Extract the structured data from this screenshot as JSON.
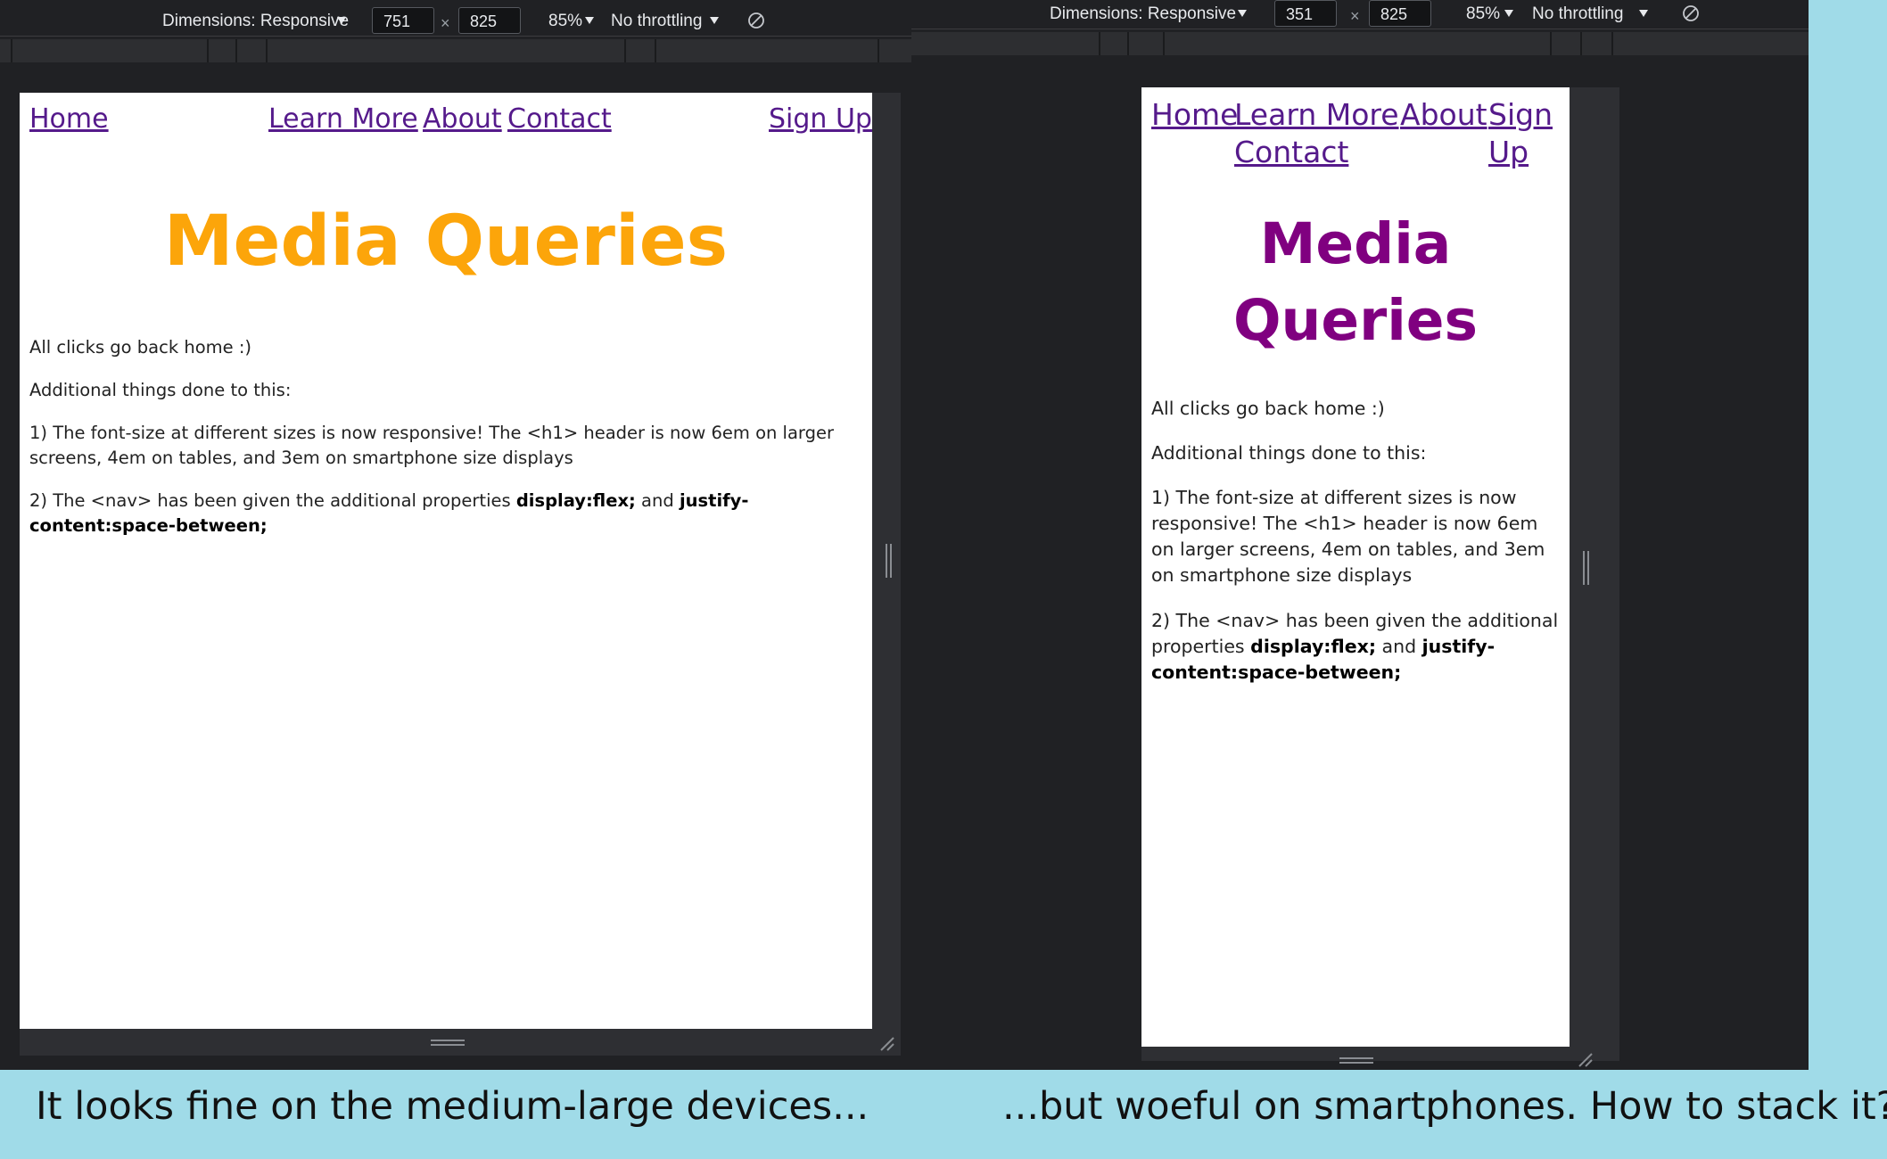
{
  "devtools": {
    "left": {
      "dimensions_label": "Dimensions: Responsive",
      "width": "751",
      "separator": "×",
      "height": "825",
      "zoom": "85%",
      "throttling": "No throttling",
      "rotate_icon": "rotate-icon"
    },
    "right": {
      "dimensions_label": "Dimensions: Responsive",
      "width": "351",
      "separator": "×",
      "height": "825",
      "zoom": "85%",
      "throttling": "No throttling",
      "rotate_icon": "rotate-icon"
    }
  },
  "page": {
    "nav": {
      "home": "Home",
      "learn_more": "Learn More",
      "about": "About",
      "contact": "Contact",
      "sign_up": "Sign Up",
      "sign": "Sign",
      "up": "Up"
    },
    "title": "Media Queries",
    "title_word1": "Media",
    "title_word2": "Queries",
    "p1": "All clicks go back home :)",
    "p2": "Additional things done to this:",
    "p3": "1) The font-size at different sizes is now responsive! The <h1> header is now 6em on larger screens, 4em on tables, and 3em on smartphone size displays",
    "p4_prefix": "2) The <nav> has been given the additional properties ",
    "p4_bold1": "display:flex;",
    "p4_mid": " and ",
    "p4_bold2": "justify-content:space-between;",
    "left_title_color": "#fca50a",
    "right_title_color": "#800080",
    "link_color": "#551a8b"
  },
  "captions": {
    "left": "It looks fine on the medium-large devices...",
    "right": "...but woeful on smartphones.  How to stack it?"
  }
}
